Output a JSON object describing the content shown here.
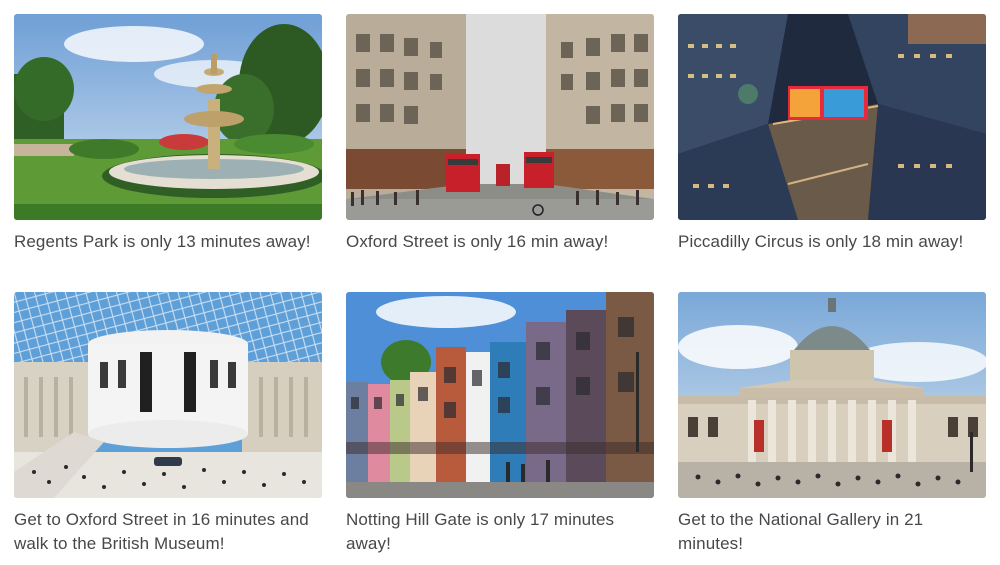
{
  "cards": [
    {
      "caption": "Regents Park is only 13 minutes away!",
      "image": "regents-park-fountain"
    },
    {
      "caption": "Oxford Street is only 16 min away!",
      "image": "oxford-street-buses"
    },
    {
      "caption": "Piccadilly Circus is only 18 min away!",
      "image": "piccadilly-circus-night"
    },
    {
      "caption": "Get to Oxford Street in 16 minutes and walk to the British Museum!",
      "image": "british-museum-great-court"
    },
    {
      "caption": "Notting Hill Gate is only 17 minutes away!",
      "image": "notting-hill-houses"
    },
    {
      "caption": "Get to the National Gallery in 21 minutes!",
      "image": "national-gallery-facade"
    }
  ]
}
